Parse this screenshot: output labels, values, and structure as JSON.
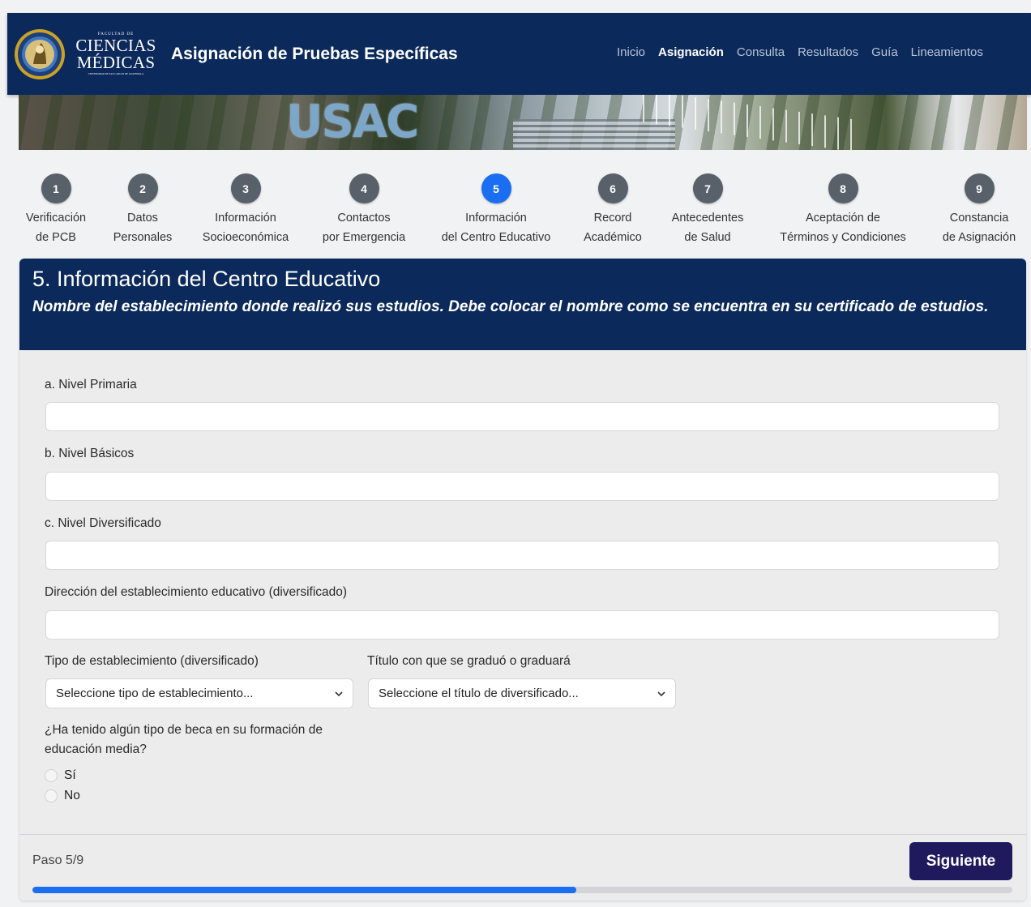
{
  "header": {
    "logo": {
      "line_small": "FACULTAD DE",
      "line1": "CIENCIAS",
      "line2": "MÉDICAS",
      "line_tiny": "UNIVERSIDAD DE SAN CARLOS DE GUATEMALA"
    },
    "title": "Asignación de Pruebas Específicas",
    "nav": [
      {
        "label": "Inicio",
        "active": false
      },
      {
        "label": "Asignación",
        "active": true
      },
      {
        "label": "Consulta",
        "active": false
      },
      {
        "label": "Resultados",
        "active": false
      },
      {
        "label": "Guía",
        "active": false
      },
      {
        "label": "Lineamientos",
        "active": false
      }
    ]
  },
  "banner": {
    "text": "USAC"
  },
  "steps": [
    {
      "num": "1",
      "line1": "Verificación",
      "line2": "de PCB",
      "active": false
    },
    {
      "num": "2",
      "line1": "Datos",
      "line2": "Personales",
      "active": false
    },
    {
      "num": "3",
      "line1": "Información",
      "line2": "Socioeconómica",
      "active": false
    },
    {
      "num": "4",
      "line1": "Contactos",
      "line2": "por Emergencia",
      "active": false
    },
    {
      "num": "5",
      "line1": "Información",
      "line2": "del Centro Educativo",
      "active": true
    },
    {
      "num": "6",
      "line1": "Record",
      "line2": "Académico",
      "active": false
    },
    {
      "num": "7",
      "line1": "Antecedentes",
      "line2": "de Salud",
      "active": false
    },
    {
      "num": "8",
      "line1": "Aceptación de",
      "line2": "Términos y Condiciones",
      "active": false
    },
    {
      "num": "9",
      "line1": "Constancia",
      "line2": "de Asignación",
      "active": false
    }
  ],
  "form": {
    "title": "5. Información del Centro Educativo",
    "subtitle": "Nombre del establecimiento donde realizó sus estudios. Debe colocar el nombre como se encuentra en su certificado de estudios.",
    "primaria": {
      "label": "a. Nivel Primaria",
      "value": ""
    },
    "basicos": {
      "label": "b. Nivel Básicos",
      "value": ""
    },
    "diversificado": {
      "label": "c. Nivel Diversificado",
      "value": ""
    },
    "direccion": {
      "label": "Dirección del establecimiento educativo (diversificado)",
      "value": ""
    },
    "tipo": {
      "label": "Tipo de establecimiento (diversificado)",
      "selected": "Seleccione tipo de establecimiento..."
    },
    "titulo": {
      "label": "Título con que se graduó o graduará",
      "selected": "Seleccione el título de diversificado..."
    },
    "beca": {
      "question": "¿Ha tenido algún tipo de beca en su formación de educación media?",
      "options": [
        "Sí",
        "No"
      ]
    }
  },
  "footer": {
    "step_text": "Paso 5/9",
    "next_label": "Siguiente",
    "progress": 0.555
  },
  "colors": {
    "navy": "#0b2a5b",
    "active_blue": "#1a6ef2",
    "button": "#1f1a5e",
    "step_gray": "#586069"
  }
}
